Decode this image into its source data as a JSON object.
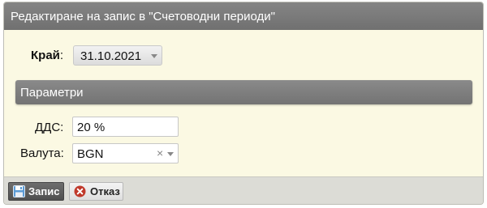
{
  "dialog": {
    "title": "Редактиране на запис в \"Счетоводни периоди\""
  },
  "end_field": {
    "label": "Край",
    "colon": ":",
    "value": "31.10.2021"
  },
  "section": {
    "title": "Параметри"
  },
  "vat_field": {
    "label": "ДДС:",
    "value": "20 %"
  },
  "currency_field": {
    "label": "Валута:",
    "value": "BGN",
    "clear": "×"
  },
  "footer": {
    "save_label": "Запис",
    "cancel_label": "Отказ"
  },
  "icons": {
    "save": "floppy-disk-icon",
    "cancel": "cancel-circle-icon",
    "dropdown": "chevron-down-icon"
  },
  "colors": {
    "title_bar": "#7b7b7b",
    "dialog_background": "#fbf9e3",
    "cancel_icon": "#c0392b",
    "save_icon": "#5b9bd5"
  }
}
